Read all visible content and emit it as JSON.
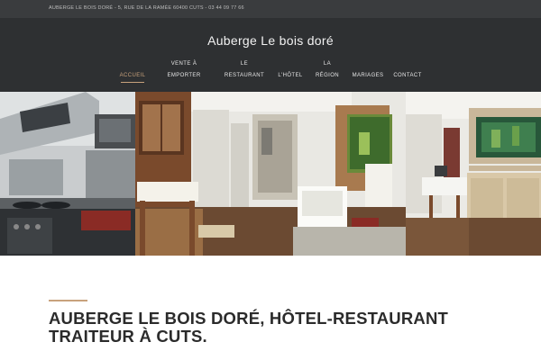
{
  "topbar": {
    "text": "AUBERGE LE BOIS DORÉ - 5, RUE DE LA RAMÉE 60400 CUTS - 03 44 09 77 66"
  },
  "header": {
    "title": "Auberge Le bois doré"
  },
  "nav": {
    "accueil": "ACCUEIL",
    "vente_line1": "VENTE À",
    "vente_line2": "EMPORTER",
    "restaurant_line1": "LE",
    "restaurant_line2": "RESTAURANT",
    "hotel": "L'HÔTEL",
    "region_line1": "LA",
    "region_line2": "RÉGION",
    "mariages": "MARIAGES",
    "contact": "CONTACT"
  },
  "slider": {
    "slide_count": 19,
    "active_slide": 0
  },
  "content": {
    "headline_line1": "AUBERGE LE BOIS DORÉ, HÔTEL-RESTAURANT",
    "headline_line2": "TRAITEUR À CUTS."
  },
  "colors": {
    "accent": "#c8a27c",
    "header_bg": "#2e3032",
    "topbar_bg": "#3a3c3e"
  }
}
